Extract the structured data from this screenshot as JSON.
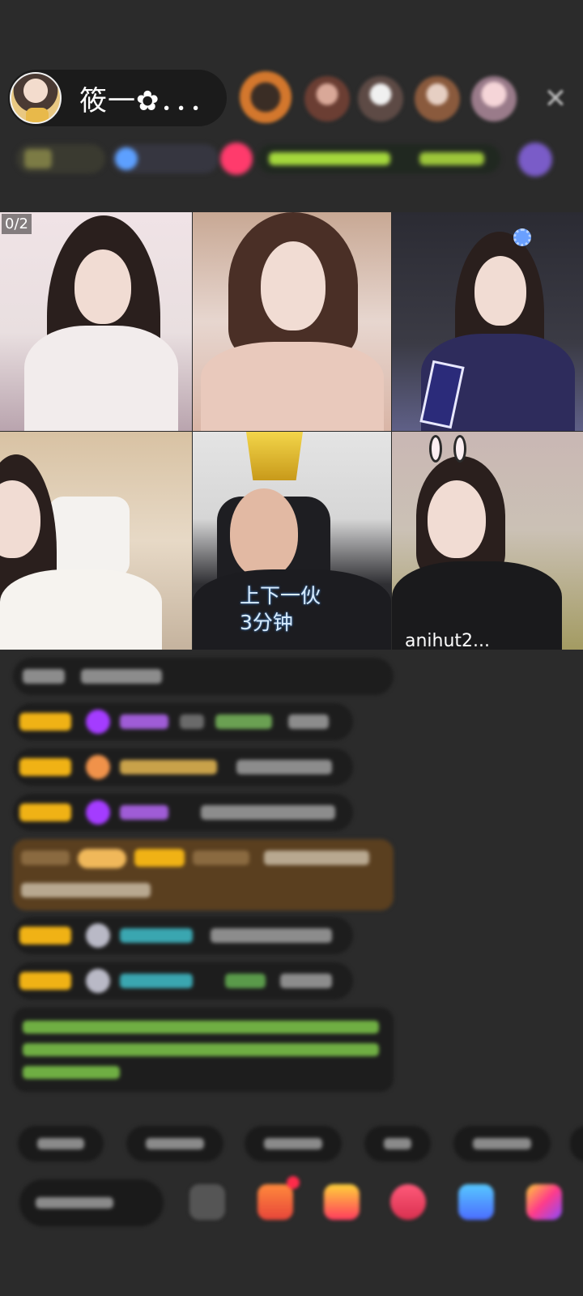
{
  "host": {
    "name": "筱一✿．．．"
  },
  "video_grid": {
    "counter": "0/2",
    "caption_line1": "上下一伙",
    "caption_line2": "3分钟",
    "tile6_text": "anihut2..."
  },
  "colors": {
    "background": "#2b2b2b",
    "pill": "#1b1b1b",
    "badge_gold": "#f0b215",
    "gift_accent": "#ff3b6c"
  }
}
